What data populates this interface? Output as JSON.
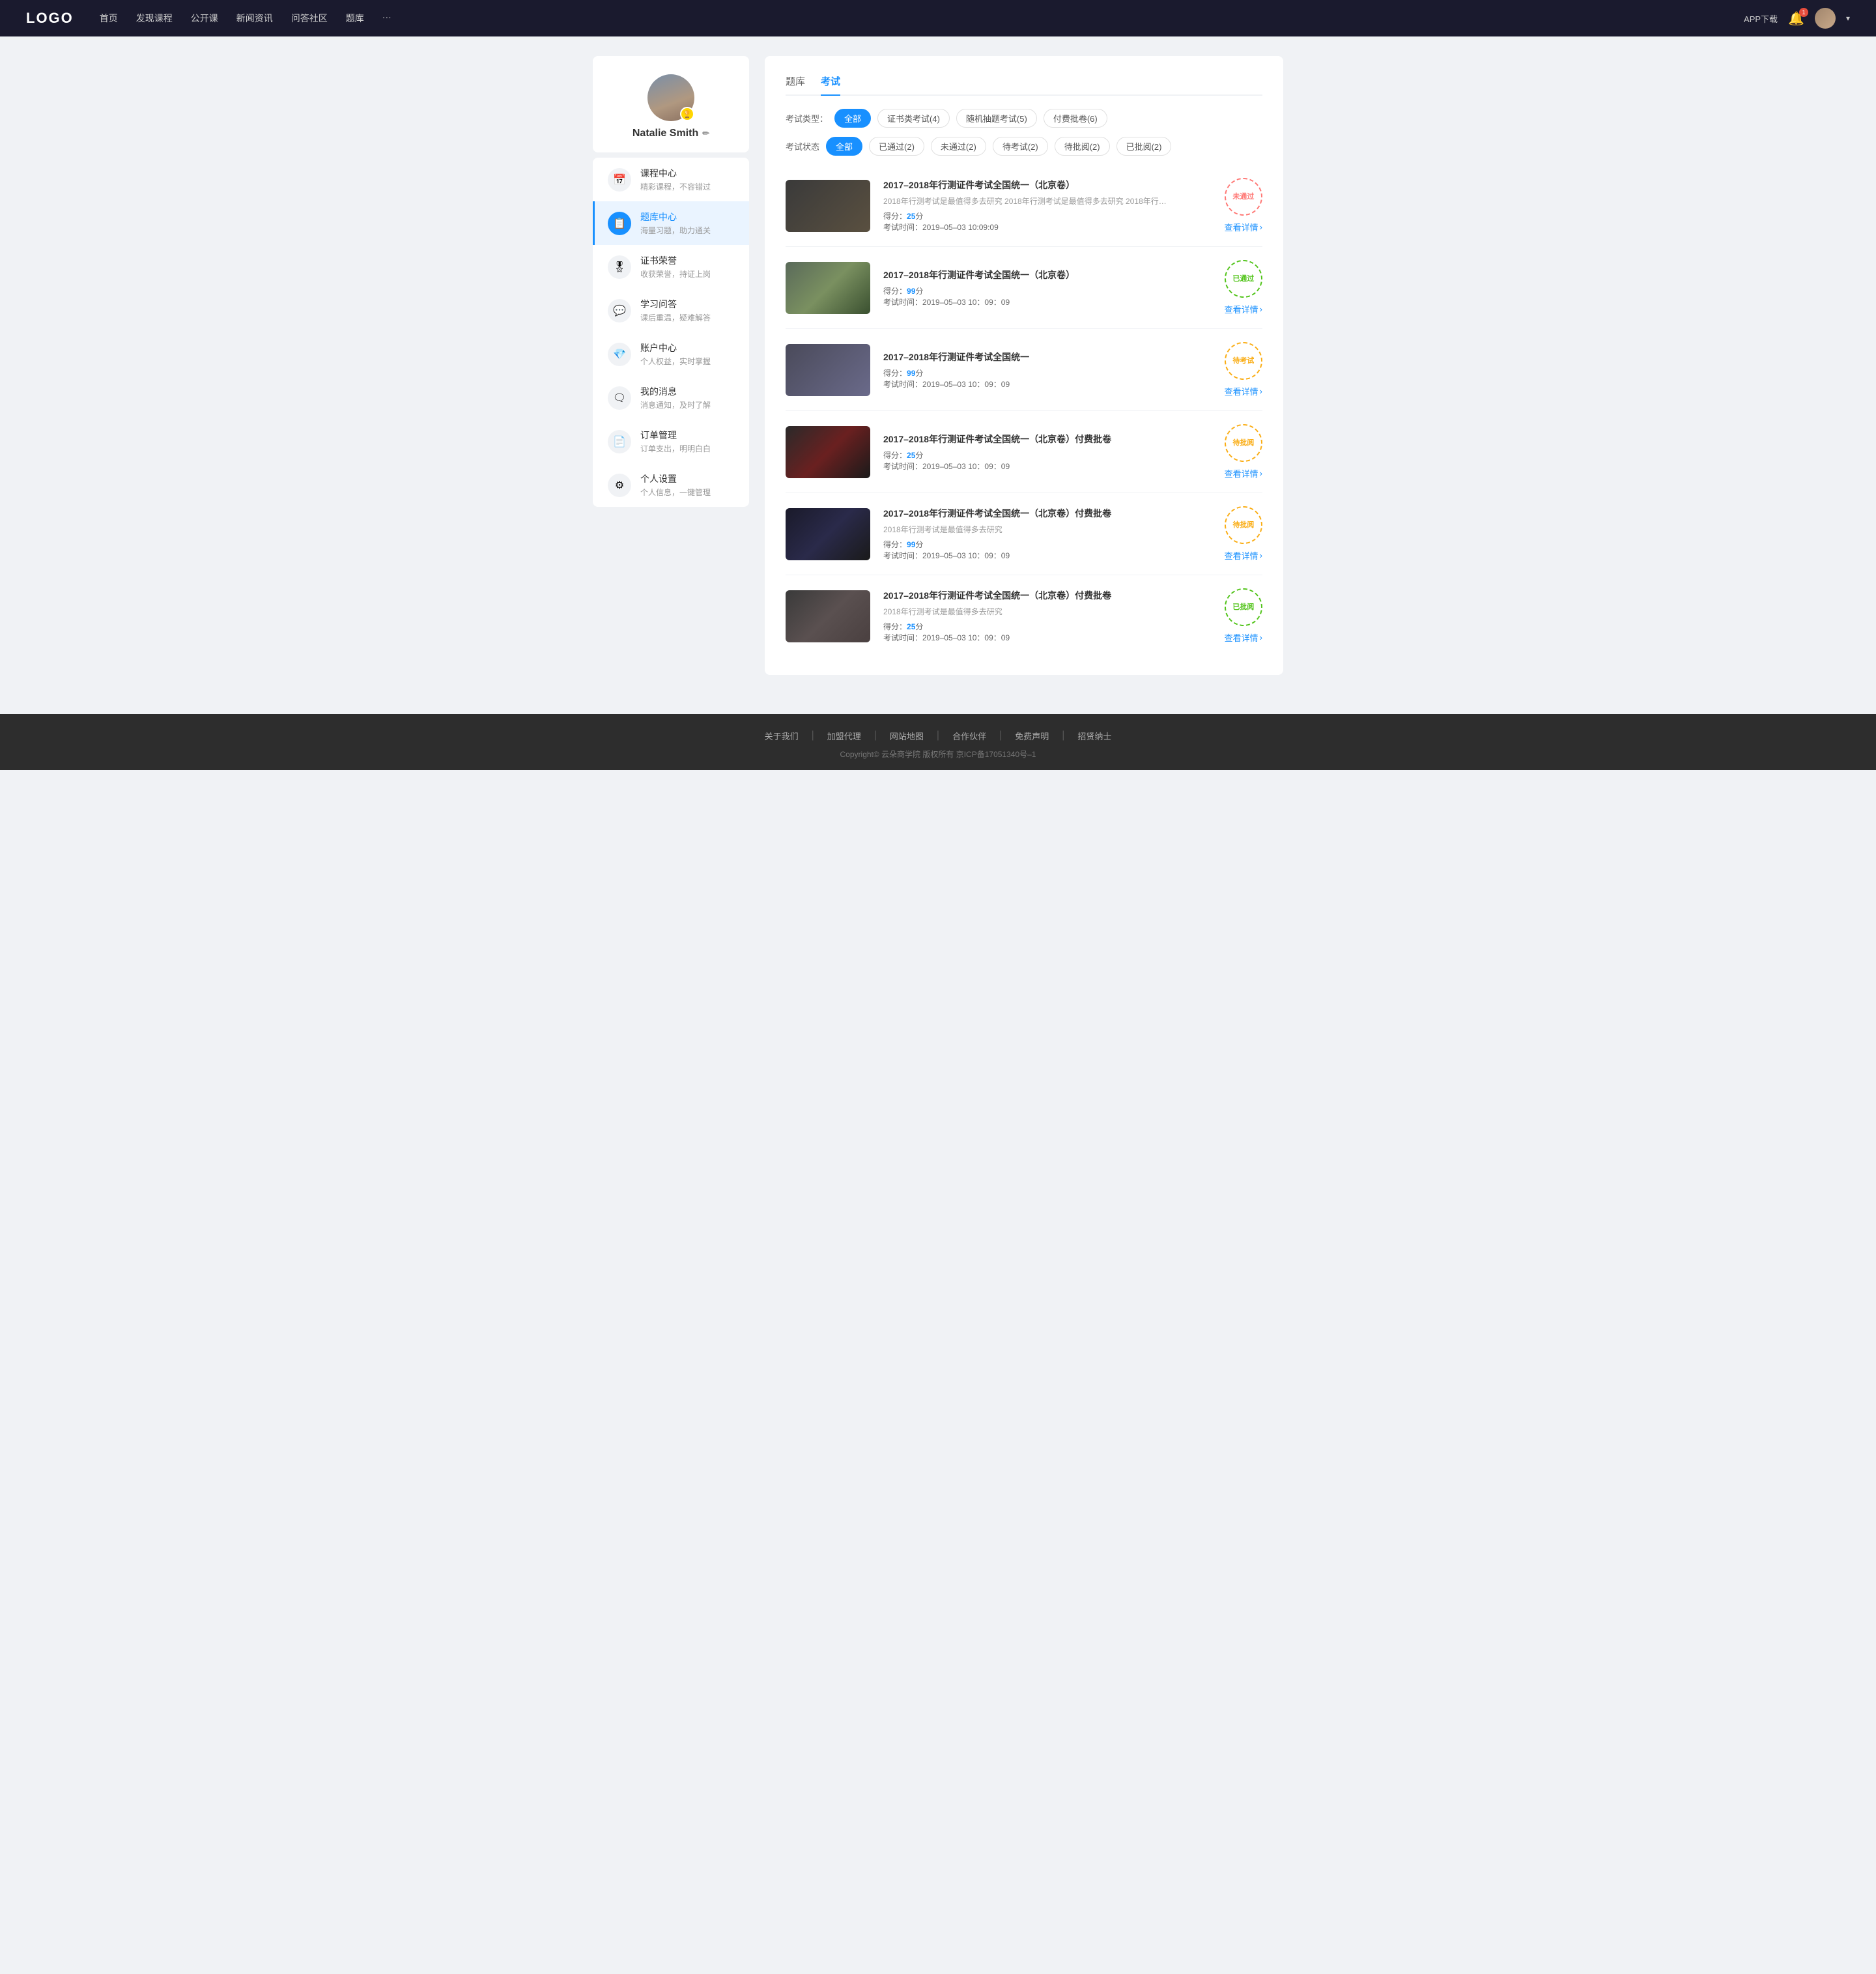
{
  "navbar": {
    "logo": "LOGO",
    "menu": [
      {
        "label": "首页",
        "id": "home"
      },
      {
        "label": "发现课程",
        "id": "discover"
      },
      {
        "label": "公开课",
        "id": "open-course"
      },
      {
        "label": "新闻资讯",
        "id": "news"
      },
      {
        "label": "问答社区",
        "id": "qa"
      },
      {
        "label": "题库",
        "id": "question-bank"
      },
      {
        "label": "···",
        "id": "more"
      }
    ],
    "app_download": "APP下载",
    "bell_badge": "1",
    "chevron": "▾"
  },
  "sidebar": {
    "username": "Natalie Smith",
    "badge": "🏆",
    "edit_icon": "✏",
    "nav_items": [
      {
        "id": "course-center",
        "icon": "📅",
        "label": "课程中心",
        "desc": "精彩课程，不容错过",
        "active": false
      },
      {
        "id": "question-bank",
        "icon": "📋",
        "label": "题库中心",
        "desc": "海量习题，助力通关",
        "active": true
      },
      {
        "id": "certificate",
        "icon": "🎖",
        "label": "证书荣誉",
        "desc": "收获荣誉，持证上岗",
        "active": false
      },
      {
        "id": "study-qa",
        "icon": "💬",
        "label": "学习问答",
        "desc": "课后重温，疑难解答",
        "active": false
      },
      {
        "id": "account",
        "icon": "💎",
        "label": "账户中心",
        "desc": "个人权益，实时掌握",
        "active": false
      },
      {
        "id": "messages",
        "icon": "🗨",
        "label": "我的消息",
        "desc": "消息通知，及时了解",
        "active": false
      },
      {
        "id": "orders",
        "icon": "📄",
        "label": "订单管理",
        "desc": "订单支出，明明白白",
        "active": false
      },
      {
        "id": "settings",
        "icon": "⚙",
        "label": "个人设置",
        "desc": "个人信息，一键管理",
        "active": false
      }
    ]
  },
  "main": {
    "tabs": [
      {
        "label": "题库",
        "active": false
      },
      {
        "label": "考试",
        "active": true
      }
    ],
    "exam_type_label": "考试类型：",
    "exam_type_filters": [
      {
        "label": "全部",
        "active": true
      },
      {
        "label": "证书类考试(4)",
        "active": false
      },
      {
        "label": "随机抽题考试(5)",
        "active": false
      },
      {
        "label": "付费批卷(6)",
        "active": false
      }
    ],
    "exam_status_label": "考试状态",
    "exam_status_filters": [
      {
        "label": "全部",
        "active": true
      },
      {
        "label": "已通过(2)",
        "active": false
      },
      {
        "label": "未通过(2)",
        "active": false
      },
      {
        "label": "待考试(2)",
        "active": false
      },
      {
        "label": "待批阅(2)",
        "active": false
      },
      {
        "label": "已批阅(2)",
        "active": false
      }
    ],
    "exams": [
      {
        "id": 1,
        "title": "2017–2018年行测证件考试全国统一（北京卷）",
        "desc": "2018年行测考试是最值得多去研究 2018年行测考试是最值得多去研究 2018年行…",
        "score_label": "得分：",
        "score": "25",
        "score_unit": "分",
        "time_label": "考试时间：",
        "time": "2019–05–03  10:09:09",
        "stamp_text": "未通过",
        "stamp_type": "fail",
        "detail_link": "查看详情",
        "thumb_class": "thumb-1"
      },
      {
        "id": 2,
        "title": "2017–2018年行测证件考试全国统一（北京卷）",
        "desc": "",
        "score_label": "得分：",
        "score": "99",
        "score_unit": "分",
        "time_label": "考试时间：",
        "time": "2019–05–03  10：09：09",
        "stamp_text": "已通过",
        "stamp_type": "pass",
        "detail_link": "查看详情",
        "thumb_class": "thumb-2"
      },
      {
        "id": 3,
        "title": "2017–2018年行测证件考试全国统一",
        "desc": "",
        "score_label": "得分：",
        "score": "99",
        "score_unit": "分",
        "time_label": "考试时间：",
        "time": "2019–05–03  10：09：09",
        "stamp_text": "待考试",
        "stamp_type": "pending",
        "detail_link": "查看详情",
        "thumb_class": "thumb-3"
      },
      {
        "id": 4,
        "title": "2017–2018年行测证件考试全国统一（北京卷）付费批卷",
        "desc": "",
        "score_label": "得分：",
        "score": "25",
        "score_unit": "分",
        "time_label": "考试时间：",
        "time": "2019–05–03  10：09：09",
        "stamp_text": "待批阅",
        "stamp_type": "reviewing",
        "detail_link": "查看详情",
        "thumb_class": "thumb-4"
      },
      {
        "id": 5,
        "title": "2017–2018年行测证件考试全国统一（北京卷）付费批卷",
        "desc": "2018年行测考试是最值得多去研究",
        "score_label": "得分：",
        "score": "99",
        "score_unit": "分",
        "time_label": "考试时间：",
        "time": "2019–05–03  10：09：09",
        "stamp_text": "待批阅",
        "stamp_type": "reviewing",
        "detail_link": "查看详情",
        "thumb_class": "thumb-5"
      },
      {
        "id": 6,
        "title": "2017–2018年行测证件考试全国统一（北京卷）付费批卷",
        "desc": "2018年行测考试是最值得多去研究",
        "score_label": "得分：",
        "score": "25",
        "score_unit": "分",
        "time_label": "考试时间：",
        "time": "2019–05–03  10：09：09",
        "stamp_text": "已批阅",
        "stamp_type": "reviewed",
        "detail_link": "查看详情",
        "thumb_class": "thumb-6"
      }
    ]
  },
  "footer": {
    "links": [
      {
        "label": "关于我们"
      },
      {
        "label": "加盟代理"
      },
      {
        "label": "网站地图"
      },
      {
        "label": "合作伙伴"
      },
      {
        "label": "免费声明"
      },
      {
        "label": "招贤纳士"
      }
    ],
    "copyright": "Copyright©  云朵商学院  版权所有    京ICP备17051340号–1"
  }
}
